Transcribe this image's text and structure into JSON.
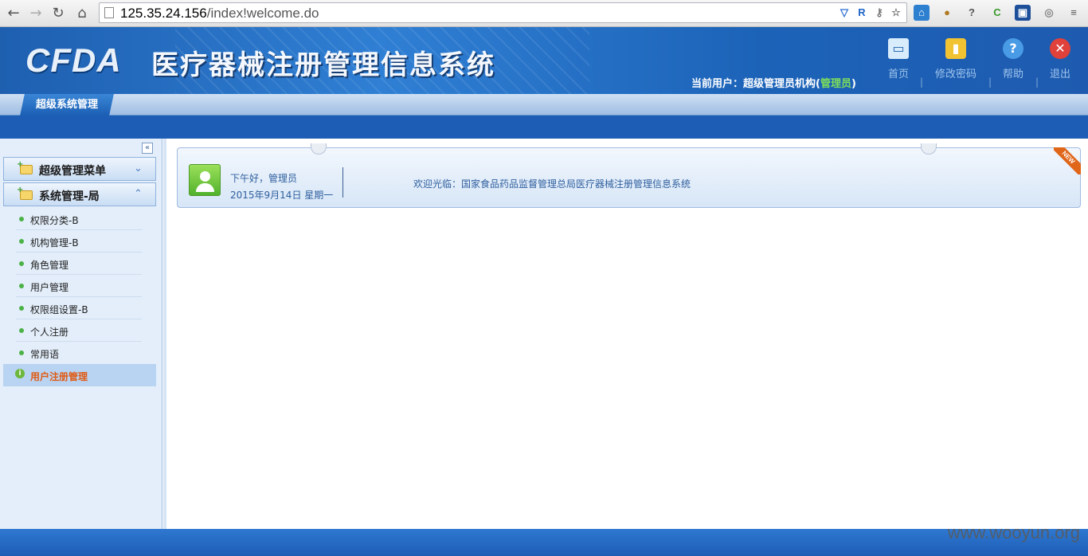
{
  "browser": {
    "url_host": "125.35.24.156",
    "url_path": "/index!welcome.do"
  },
  "header": {
    "logo": "CFDA",
    "title": "医疗器械注册管理信息系统",
    "current_user_label": "当前用户：超级管理员机构(",
    "current_user_role": "管理员",
    "current_user_suffix": ")",
    "links": [
      {
        "label": "首页",
        "icon": "monitor-icon"
      },
      {
        "label": "修改密码",
        "icon": "lock-icon"
      },
      {
        "label": "帮助",
        "icon": "help-icon"
      },
      {
        "label": "退出",
        "icon": "exit-icon"
      }
    ],
    "separator": "|"
  },
  "tabs": {
    "active": "超级系统管理"
  },
  "sidebar": {
    "collapse_glyph": "«",
    "groups": [
      {
        "label": "超级管理菜单",
        "chevron": "⌄"
      },
      {
        "label": "系统管理-局",
        "chevron": "⌃"
      }
    ],
    "items": [
      {
        "label": "权限分类-B"
      },
      {
        "label": "机构管理-B"
      },
      {
        "label": "角色管理"
      },
      {
        "label": "用户管理"
      },
      {
        "label": "权限组设置-B"
      },
      {
        "label": "个人注册"
      },
      {
        "label": "常用语"
      }
    ],
    "active_item": "用户注册管理"
  },
  "welcome": {
    "greeting": "下午好，管理员",
    "date": "2015年9月14日  星期一",
    "message": "欢迎光临：国家食品药品监督管理总局医疗器械注册管理信息系统",
    "badge": "NEW"
  },
  "watermark": "www.wooyun.org",
  "colors": {
    "header_blue": "#1e5fb0",
    "accent_green": "#7fe05a",
    "active_item_orange": "#e05a12"
  }
}
